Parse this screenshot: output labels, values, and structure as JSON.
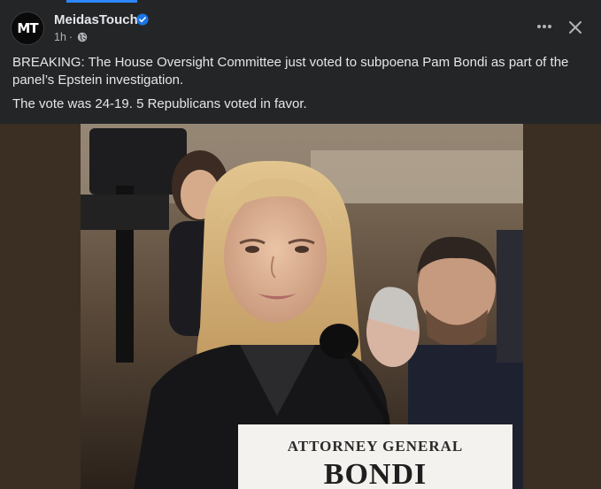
{
  "post": {
    "page_name": "MeidasTouch",
    "avatar_text": "MT",
    "time": "1h",
    "separator": "·",
    "text_lines": [
      "BREAKING: The House Oversight Committee just voted to subpoena Pam Bondi as part of the panel’s Epstein investigation.",
      "The vote was 24-19. 5 Republicans voted in favor."
    ]
  },
  "image": {
    "nameplate_line1": "ATTORNEY GENERAL",
    "nameplate_line2": "BONDI"
  },
  "icons": {
    "verified": "verified-badge-icon",
    "privacy": "globe-icon",
    "more": "more-options-icon",
    "close": "close-icon"
  },
  "colors": {
    "background": "#242526",
    "text_primary": "#e4e6eb",
    "text_secondary": "#b0b3b8",
    "accent": "#2d88ff",
    "verified": "#1b74e4"
  }
}
